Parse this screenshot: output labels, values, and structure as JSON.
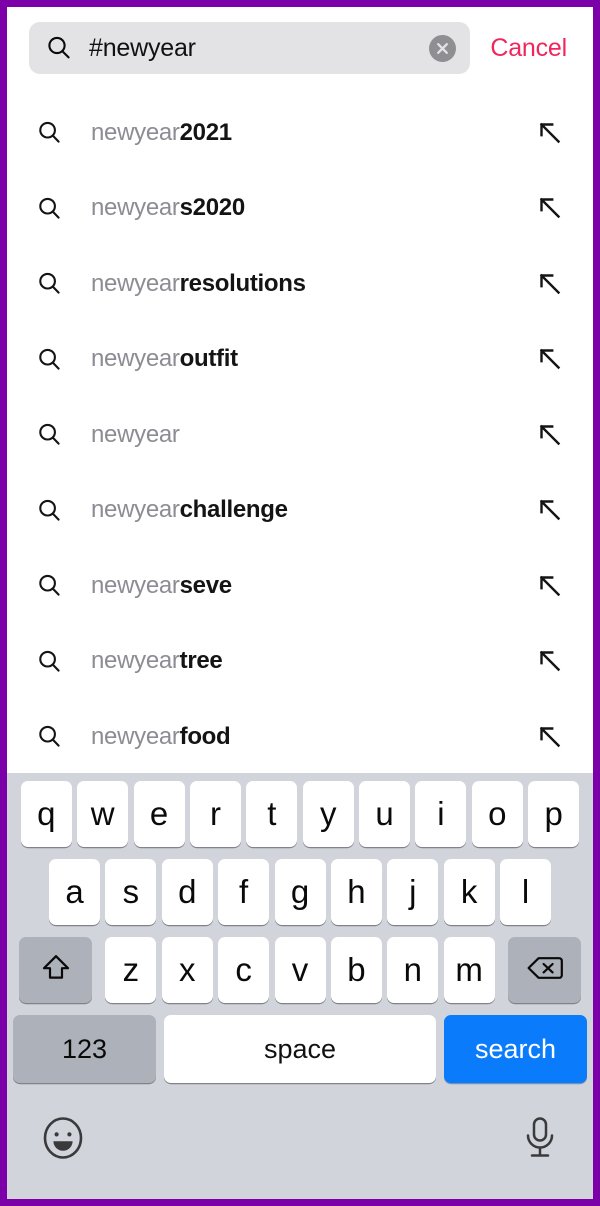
{
  "app": {
    "device_frame_color": "#7b00a8",
    "screen_background": "#ffffff"
  },
  "search": {
    "icon": "search-icon",
    "value": "#newyear",
    "placeholder": "Search",
    "clear_icon": "clear-circle-x-icon",
    "cancel_label": "Cancel",
    "cancel_color": "#f0265c",
    "field_background": "#e3e3e5"
  },
  "suggestions": {
    "prefix": "newyear",
    "row_icon": "search-icon",
    "trailing_icon": "arrow-up-left-icon",
    "items": [
      {
        "prefix": "newyear",
        "bold": "2021",
        "full": "newyear2021"
      },
      {
        "prefix": "newyear",
        "bold": "s2020",
        "full": "newyears2020"
      },
      {
        "prefix": "newyear",
        "bold": "resolutions",
        "full": "newyearresolutions"
      },
      {
        "prefix": "newyear",
        "bold": "outfit",
        "full": "newyearoutfit"
      },
      {
        "prefix": "newyear",
        "bold": "",
        "full": "newyear"
      },
      {
        "prefix": "newyear",
        "bold": "challenge",
        "full": "newyearchallenge"
      },
      {
        "prefix": "newyear",
        "bold": "seve",
        "full": "newyearseve"
      },
      {
        "prefix": "newyear",
        "bold": "tree",
        "full": "newyeartree"
      },
      {
        "prefix": "newyear",
        "bold": "food",
        "full": "newyearfood"
      }
    ]
  },
  "keyboard": {
    "background": "#d1d4da",
    "key_background": "#ffffff",
    "modifier_background": "#adb1ba",
    "accent": "#0a7cfb",
    "row1": [
      "q",
      "w",
      "e",
      "r",
      "t",
      "y",
      "u",
      "i",
      "o",
      "p"
    ],
    "row2": [
      "a",
      "s",
      "d",
      "f",
      "g",
      "h",
      "j",
      "k",
      "l"
    ],
    "row3": [
      "z",
      "x",
      "c",
      "v",
      "b",
      "n",
      "m"
    ],
    "shift_icon": "shift-arrow-up-icon",
    "backspace_icon": "backspace-delete-icon",
    "numbers_label": "123",
    "space_label": "space",
    "search_label": "search",
    "emoji_icon": "emoji-smiley-icon",
    "dictation_icon": "microphone-icon"
  }
}
